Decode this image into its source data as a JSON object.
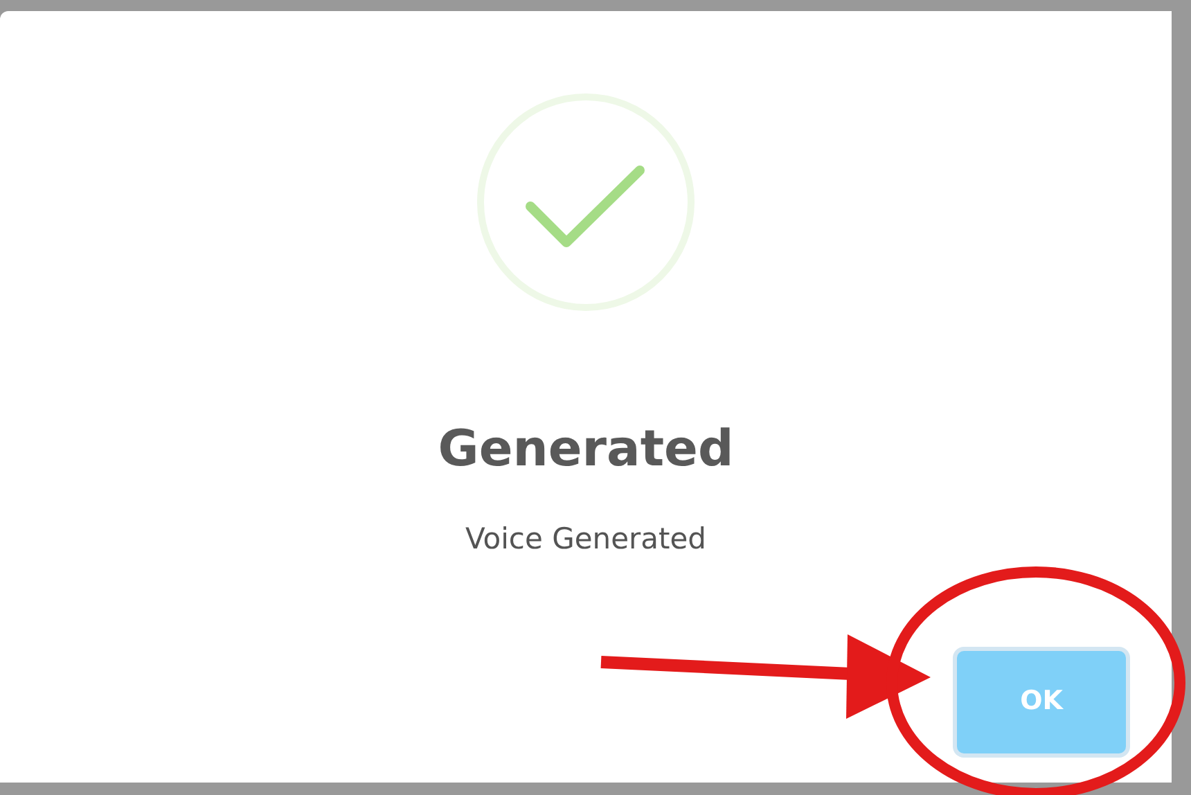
{
  "dialog": {
    "title": "Generated",
    "message": "Voice Generated",
    "buttons": [
      {
        "label": "OK",
        "kind": "confirm"
      }
    ]
  }
}
